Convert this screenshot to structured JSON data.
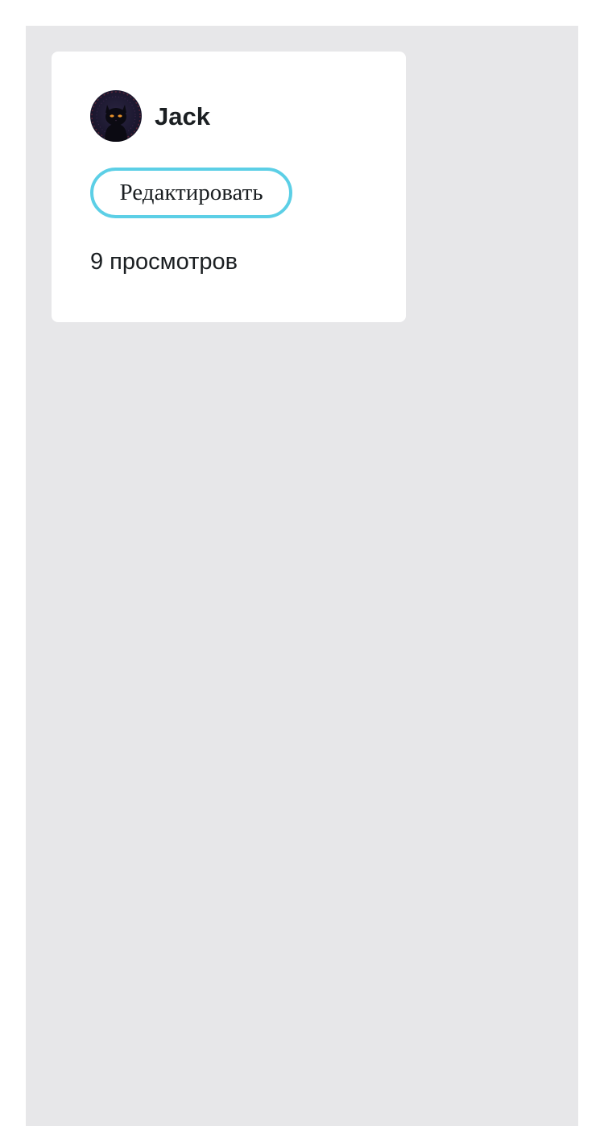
{
  "profile_card": {
    "user": {
      "name": "Jack",
      "avatar_icon": "black-cat-avatar-icon"
    },
    "edit_button_label": "Редактировать",
    "views_text": "9 просмотров"
  },
  "colors": {
    "page_background": "#e7e7e9",
    "card_background": "#ffffff",
    "button_border": "#5ccfe6",
    "text": "#1b1f22"
  }
}
